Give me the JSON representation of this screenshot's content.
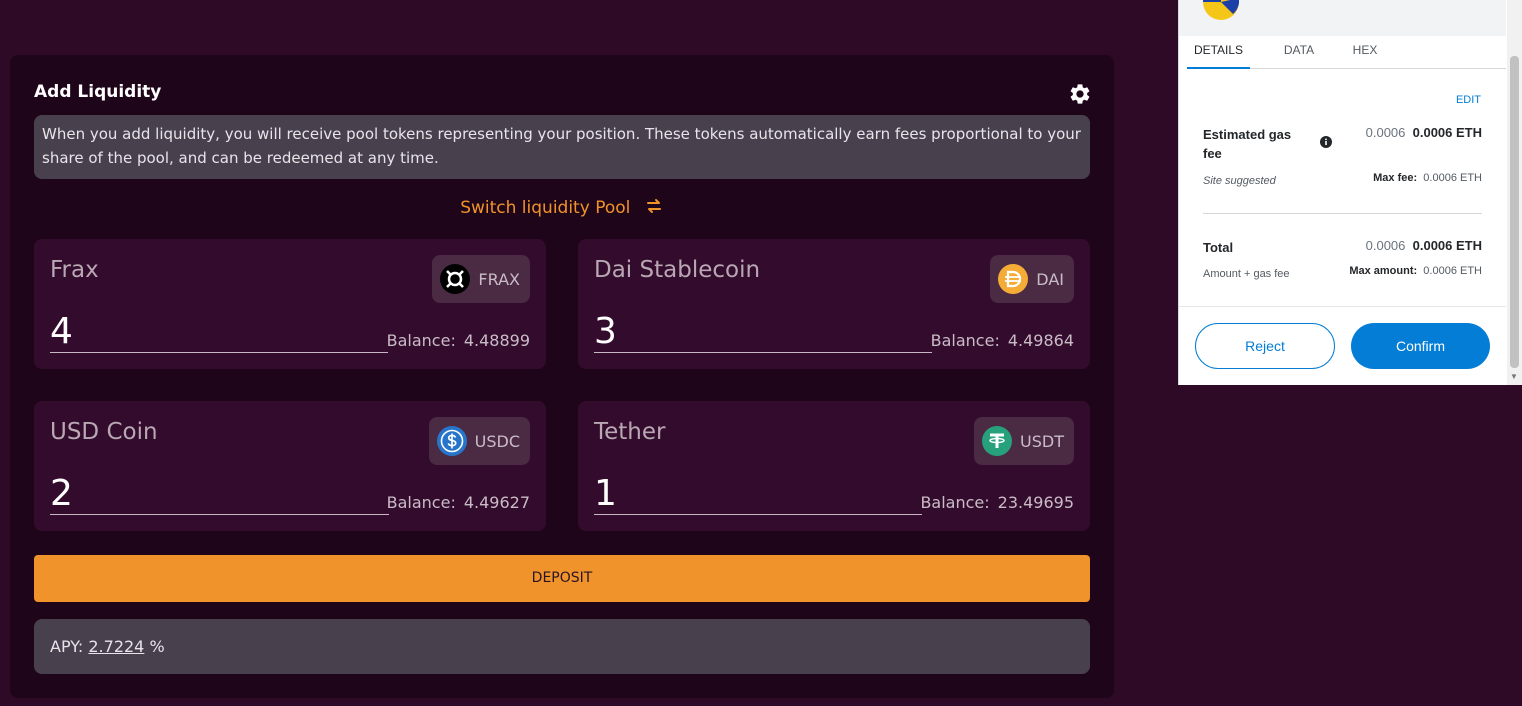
{
  "panel": {
    "title": "Add Liquidity",
    "info": "When you add liquidity, you will receive pool tokens representing your position. These tokens automatically earn fees proportional to your share of the pool, and can be redeemed at any time.",
    "switch_label": "Switch liquidity Pool",
    "tokens": [
      {
        "name": "Frax",
        "symbol": "FRAX",
        "amount": "4",
        "balance_label": "Balance:",
        "balance": "4.48899",
        "icon": "frax-icon"
      },
      {
        "name": "Dai Stablecoin",
        "symbol": "DAI",
        "amount": "3",
        "balance_label": "Balance:",
        "balance": "4.49864",
        "icon": "dai-icon"
      },
      {
        "name": "USD Coin",
        "symbol": "USDC",
        "amount": "2",
        "balance_label": "Balance:",
        "balance": "4.49627",
        "icon": "usdc-icon"
      },
      {
        "name": "Tether",
        "symbol": "USDT",
        "amount": "1",
        "balance_label": "Balance:",
        "balance": "23.49695",
        "icon": "usdt-icon"
      }
    ],
    "deposit_label": "DEPOSIT",
    "apy_label": "APY:",
    "apy_value": "2.7224",
    "apy_unit": "%"
  },
  "wallet": {
    "tabs": [
      "DETAILS",
      "DATA",
      "HEX"
    ],
    "active_tab": "DETAILS",
    "edit_label": "EDIT",
    "gas_label": "Estimated gas fee",
    "gas_value": "0.0006",
    "gas_value_eth": "0.0006 ETH",
    "site_suggested": "Site suggested",
    "max_fee_label": "Max fee:",
    "max_fee_value": "0.0006 ETH",
    "total_label": "Total",
    "total_value": "0.0006",
    "total_value_eth": "0.0006 ETH",
    "amount_gas_label": "Amount + gas fee",
    "max_amount_label": "Max amount:",
    "max_amount_value": "0.0006 ETH",
    "reject_label": "Reject",
    "confirm_label": "Confirm"
  },
  "colors": {
    "accent": "#f0932b",
    "background": "#2e0a26",
    "wallet_blue": "#037dd6"
  }
}
